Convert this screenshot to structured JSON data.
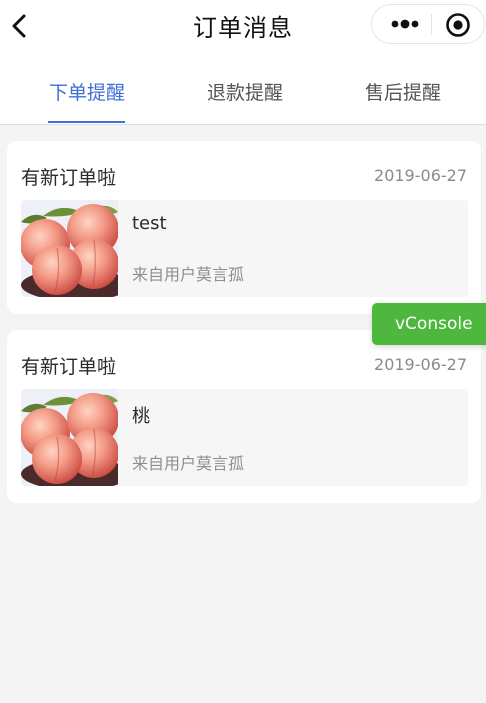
{
  "header": {
    "title": "订单消息"
  },
  "tabs": [
    {
      "label": "下单提醒",
      "active": true
    },
    {
      "label": "退款提醒",
      "active": false
    },
    {
      "label": "售后提醒",
      "active": false
    }
  ],
  "orders": [
    {
      "title": "有新订单啦",
      "date": "2019-06-27",
      "product_name": "test",
      "from_user": "来自用户莫言孤"
    },
    {
      "title": "有新订单啦",
      "date": "2019-06-27",
      "product_name": "桃",
      "from_user": "来自用户莫言孤"
    }
  ],
  "vconsole": {
    "label": "vConsole"
  },
  "colors": {
    "accent": "#3f6fd6",
    "vconsole": "#4eb73d",
    "background": "#f4f4f4"
  },
  "icons": {
    "back": "chevron-left-icon",
    "more": "more-dots-icon",
    "close": "target-close-icon",
    "thumbnail": "peach-image"
  }
}
